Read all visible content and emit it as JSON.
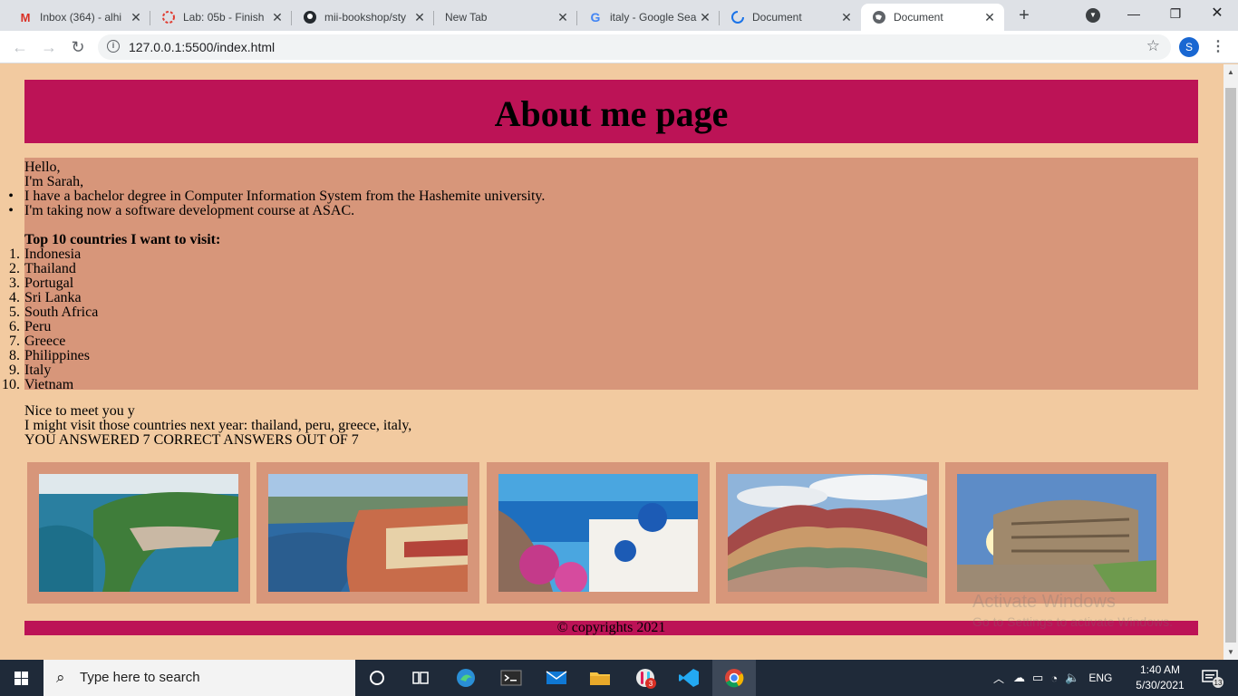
{
  "browser": {
    "tabs": [
      {
        "title": "Inbox (364) - alhi"
      },
      {
        "title": "Lab: 05b - Finish"
      },
      {
        "title": "mii-bookshop/sty"
      },
      {
        "title": "New Tab"
      },
      {
        "title": "italy - Google Sea"
      },
      {
        "title": "Document"
      },
      {
        "title": "Document"
      }
    ],
    "url": "127.0.0.1:5500/index.html",
    "profile_initial": "S"
  },
  "page": {
    "heading": "About me page",
    "greeting": "Hello,",
    "intro": "I'm Sarah,",
    "bullets": [
      "I have a bachelor degree in Computer Information System from the Hashemite university.",
      "I'm taking now a software development course at ASAC."
    ],
    "countries_title": "Top 10 countries I want to visit:",
    "countries": [
      "Indonesia",
      "Thailand",
      "Portugal",
      "Sri Lanka",
      "South Africa",
      "Peru",
      "Greece",
      "Philippines",
      "Italy",
      "Vietnam"
    ],
    "nice_to_meet": "Nice to meet you y",
    "visit_next_year": "I might visit those countries next year: thailand, peru, greece, italy,",
    "score": "YOU ANSWERED 7 CORRECT ANSWERS OUT OF 7",
    "gallery": [
      {
        "icon": "coastal-island-photo"
      },
      {
        "icon": "riverside-city-photo"
      },
      {
        "icon": "santorini-village-photo"
      },
      {
        "icon": "rainbow-mountain-photo"
      },
      {
        "icon": "colosseum-photo"
      }
    ],
    "footer": "© copyrights 2021"
  },
  "watermark": {
    "line1": "Activate Windows",
    "line2": "Go to Settings to activate Windows."
  },
  "taskbar": {
    "search_placeholder": "Type here to search",
    "language": "ENG",
    "time": "1:40 AM",
    "date": "5/30/2021",
    "notification_count": "13",
    "app_badge": "3"
  }
}
